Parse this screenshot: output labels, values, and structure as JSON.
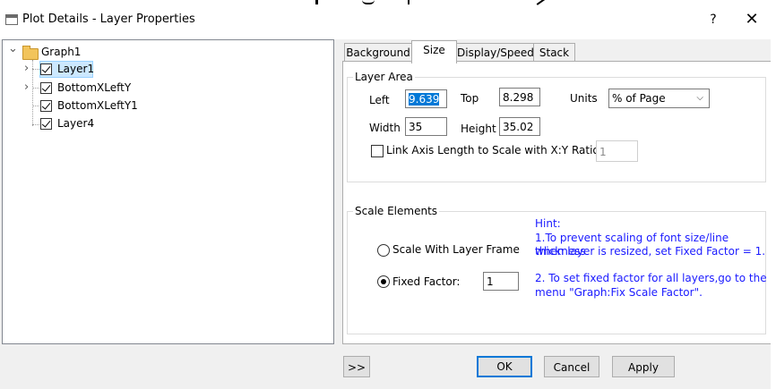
{
  "window": {
    "title": "Plot Details - Layer Properties",
    "help_label": "?",
    "close_label": "✕"
  },
  "tree": {
    "root": {
      "label": "Graph1",
      "expander": "⌄"
    },
    "items": [
      {
        "label": "Layer1",
        "expander": "›",
        "checked": true,
        "selected": true
      },
      {
        "label": "BottomXLeftY",
        "expander": "›",
        "checked": true
      },
      {
        "label": "BottomXLeftY1",
        "checked": true
      },
      {
        "label": "Layer4",
        "checked": true
      }
    ]
  },
  "tabs": [
    {
      "label": "Background"
    },
    {
      "label": "Size",
      "active": true
    },
    {
      "label": "Display/Speed"
    },
    {
      "label": "Stack"
    }
  ],
  "layer_area": {
    "title": "Layer Area",
    "left_label": "Left",
    "left_value": "9.639",
    "top_label": "Top",
    "top_value": "8.298",
    "units_label": "Units",
    "units_value": "% of Page",
    "width_label": "Width",
    "width_value": "35",
    "height_label": "Height",
    "height_value": "35.02",
    "link_label": "Link Axis Length to Scale with X:Y Ratio",
    "link_checked": false,
    "ratio_value": "1"
  },
  "scale_elements": {
    "title": "Scale Elements",
    "option_frame": "Scale With Layer Frame",
    "option_fixed": "Fixed Factor:",
    "fixed_value": "1",
    "selected": "fixed",
    "hint": {
      "line1": "Hint:",
      "line2": "1.To prevent scaling of font size/line thickness",
      "line3": "when layer is resized, set Fixed Factor = 1.",
      "line4": "2. To set fixed factor for all layers,go to the",
      "line5": "menu \"Graph:Fix Scale Factor\"."
    }
  },
  "buttons": {
    "expand": ">>",
    "ok": "OK",
    "cancel": "Cancel",
    "apply": "Apply"
  },
  "colors": {
    "hint": "#1a1aff",
    "selection": "#0078d7",
    "default_border": "#0078d7"
  }
}
